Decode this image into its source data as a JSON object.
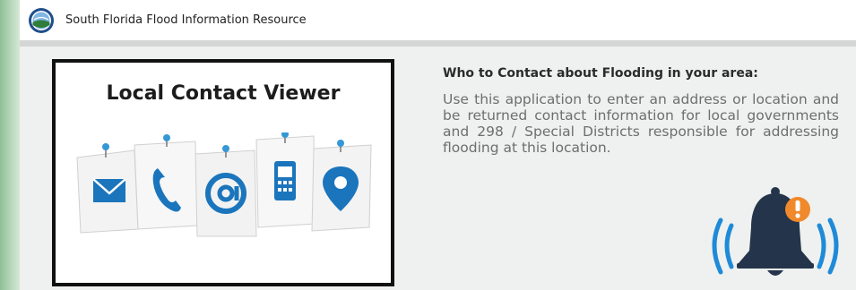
{
  "header": {
    "title": "South Florida Flood Information Resource",
    "logo_icon": "district-seal-icon"
  },
  "card": {
    "title": "Local Contact Viewer",
    "icons": [
      "envelope-icon",
      "phone-icon",
      "at-sign-icon",
      "mobile-phone-icon",
      "location-pin-icon"
    ]
  },
  "content": {
    "heading": "Who to Contact about Flooding in your area:",
    "description": "Use this application to enter an address or location and be returned contact information for local governments and 298 / Special Districts responsible for addressing flooding at this location."
  },
  "illustration": {
    "icon": "alert-bell-icon"
  },
  "colors": {
    "accent_blue": "#1b75bc",
    "bell_dark": "#24344a",
    "alert_orange": "#f0892b",
    "wave_blue": "#1f8ad8",
    "left_strip_green": "#8fbf96"
  }
}
